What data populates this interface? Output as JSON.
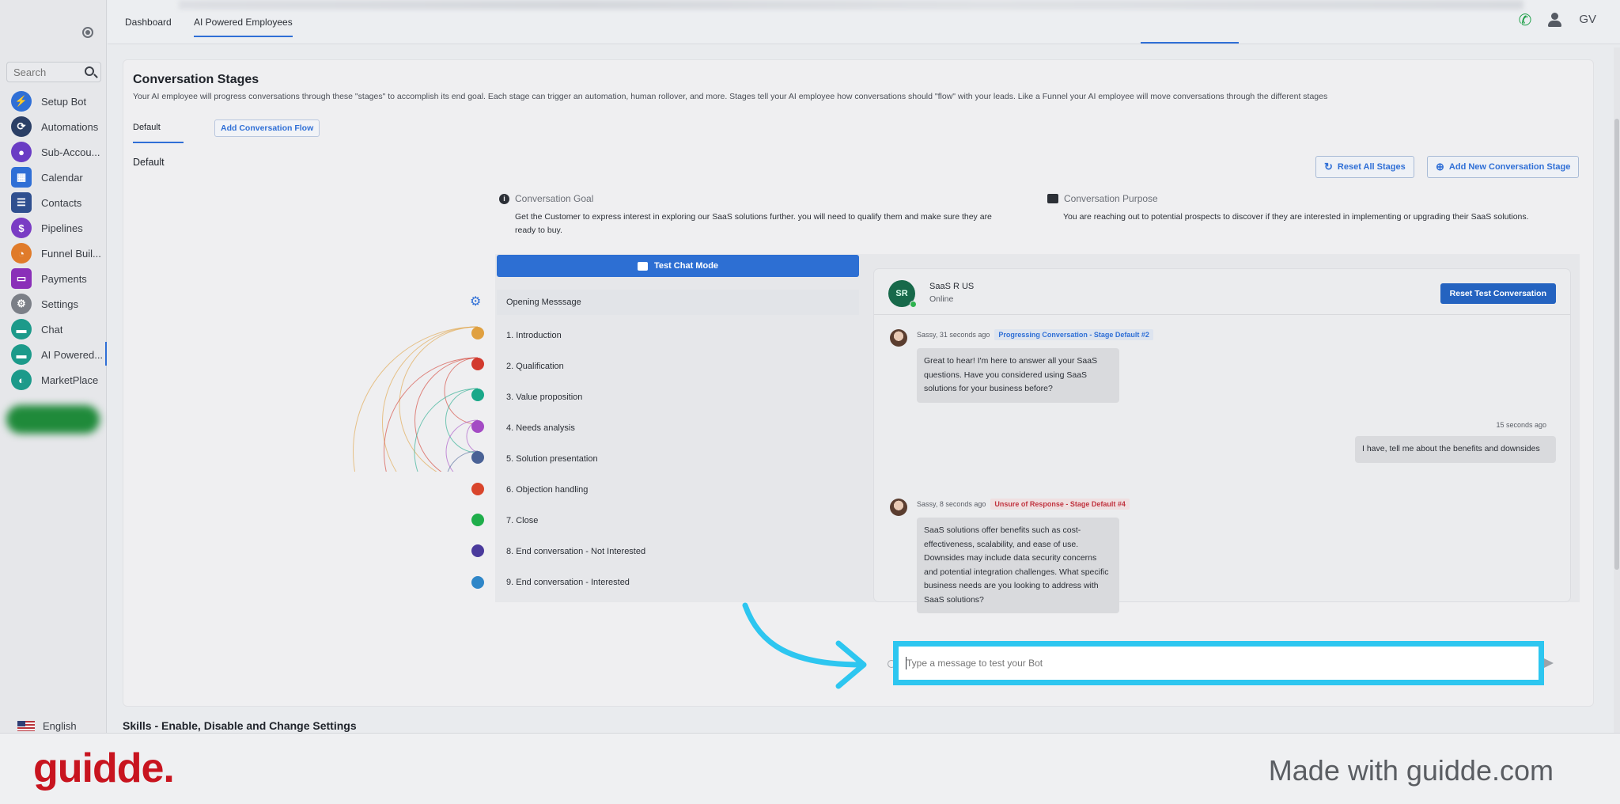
{
  "topbar": {
    "tabs": [
      "Dashboard",
      "AI Powered Employees"
    ],
    "user_initials": "GV"
  },
  "sidebar": {
    "search_placeholder": "Search",
    "items": [
      {
        "label": "Setup Bot",
        "icon": "bolt-icon",
        "color": "#2f6fd6"
      },
      {
        "label": "Automations",
        "icon": "automation-icon",
        "color": "#2b3f66"
      },
      {
        "label": "Sub-Accou...",
        "icon": "person-icon",
        "color": "#6a3cc4"
      },
      {
        "label": "Calendar",
        "icon": "calendar-icon",
        "color": "#2f6fd6"
      },
      {
        "label": "Contacts",
        "icon": "contacts-icon",
        "color": "#2f4f8f"
      },
      {
        "label": "Pipelines",
        "icon": "dollar-icon",
        "color": "#7a3cc4"
      },
      {
        "label": "Funnel Buil...",
        "icon": "funnel-icon",
        "color": "#e07b2a"
      },
      {
        "label": "Payments",
        "icon": "card-icon",
        "color": "#8a2fb8"
      },
      {
        "label": "Settings",
        "icon": "gear-icon",
        "color": "#7b7f87"
      },
      {
        "label": "Chat",
        "icon": "chat-icon",
        "color": "#1c9a8a"
      },
      {
        "label": "AI Powered...",
        "icon": "ai-chat-icon",
        "color": "#1c9a8a"
      },
      {
        "label": "MarketPlace",
        "icon": "marketplace-icon",
        "color": "#1c9a8a"
      }
    ],
    "language": "English"
  },
  "stages": {
    "title": "Conversation Stages",
    "description": "Your AI employee will progress conversations through these \"stages\" to accomplish its end goal. Each stage can trigger an automation, human rollover, and more. Stages tell your AI employee how conversations should \"flow\" with your leads. Like a Funnel your AI employee will move conversations through the different stages",
    "tab_default": "Default",
    "add_flow": "Add Conversation Flow",
    "default_label": "Default",
    "reset_all": "Reset All Stages",
    "add_new": "Add New Conversation Stage",
    "goal_title": "Conversation Goal",
    "goal_text": "Get the Customer to express interest in exploring our SaaS solutions further. you will need to qualify them and make sure they are ready to buy.",
    "purpose_title": "Conversation Purpose",
    "purpose_text": "You are reaching out to potential prospects to discover if they are interested in implementing or upgrading their SaaS solutions.",
    "test_chat_mode": "Test Chat Mode",
    "opening": "Opening Messsage",
    "list": [
      {
        "label": "1. Introduction",
        "color": "#e0a040"
      },
      {
        "label": "2. Qualification",
        "color": "#d23a2e"
      },
      {
        "label": "3. Value proposition",
        "color": "#1aa889"
      },
      {
        "label": "4. Needs analysis",
        "color": "#a44bc4"
      },
      {
        "label": "5. Solution presentation",
        "color": "#4a6296"
      },
      {
        "label": "6. Objection handling",
        "color": "#d9452c"
      },
      {
        "label": "7. Close",
        "color": "#1fae4b"
      },
      {
        "label": "8. End conversation - Not Interested",
        "color": "#4a3a9c"
      },
      {
        "label": "9. End conversation - Interested",
        "color": "#2f86c8"
      }
    ]
  },
  "chat": {
    "avatar_initials": "SR",
    "name": "SaaS R US",
    "status": "Online",
    "reset_button": "Reset Test Conversation",
    "messages": [
      {
        "meta": "Sassy, 31 seconds ago",
        "tag": "Progressing Conversation - Stage Default #2",
        "text": "Great to hear! I'm here to answer all your SaaS questions. Have you considered using SaaS solutions for your business before?"
      },
      {
        "meta": "15 seconds ago",
        "text": "I have, tell me about the benefits and downsides"
      },
      {
        "meta": "Sassy, 8 seconds ago",
        "tag": "Unsure of Response - Stage Default #4",
        "text": "SaaS solutions offer benefits such as cost-effectiveness, scalability, and ease of use. Downsides may include data security concerns and potential integration challenges. What specific business needs are you looking to address with SaaS solutions?"
      }
    ],
    "input_placeholder": "Type a message to test your Bot"
  },
  "skills_title": "Skills - Enable, Disable and Change Settings",
  "footer": {
    "logo": "guidde.",
    "made_with": "Made with guidde.com"
  }
}
